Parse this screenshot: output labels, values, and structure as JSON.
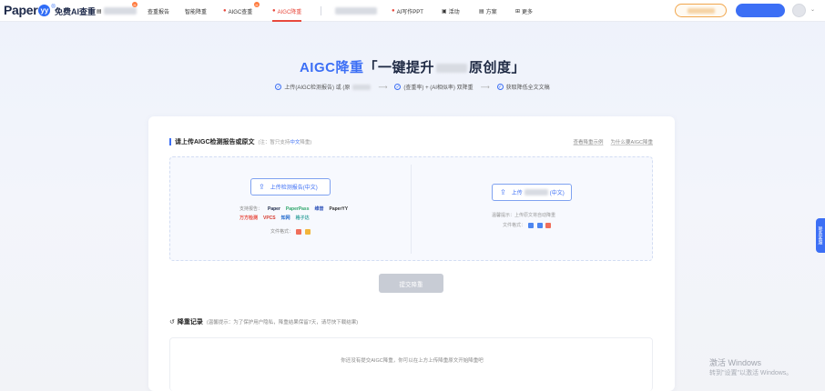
{
  "brand": {
    "logo_text": "Paper",
    "logo_badge": "yy",
    "sub_title": "免费AI查重"
  },
  "nav": {
    "items": [
      {
        "label": "查重报告",
        "icon": "report-icon"
      },
      {
        "label": "智能降重",
        "icon": ""
      },
      {
        "label": "AIGC查重",
        "icon": ""
      },
      {
        "label": "AIGC降重",
        "icon": "flame-icon",
        "active": true
      },
      {
        "label": "AI写作PPT",
        "icon": "flame-icon"
      },
      {
        "label": "活动",
        "icon": "gift-icon"
      },
      {
        "label": "方案",
        "icon": "plan-icon"
      },
      {
        "label": "更多",
        "icon": "grid-icon"
      }
    ],
    "hot_badge": "hot",
    "coin_label": "",
    "colors": {
      "active": "#e8493d",
      "accent": "#3c6ff5"
    }
  },
  "hero": {
    "title_blue": "AIGC降重",
    "title_rest_1": "「一键提升",
    "title_rest_2": "原创度」",
    "steps": [
      "上传(AIGC检测报告) 或 (原",
      "(查重率) + (AI相似率) 双降重",
      "获取降低全文文稿"
    ]
  },
  "upload": {
    "section_title": "请上传AIGC检测报告或原文",
    "section_note_pre": "(注：暂只支持",
    "section_note_hl": "中文",
    "section_note_post": "降重)",
    "link_sample": "查看降重示例",
    "link_why": "为什么要AIGC降重",
    "left_button": "上传检测报告(中文)",
    "left_support_label": "支持报告：",
    "left_format_label": "文件格式：",
    "partner_logos": [
      "Paper",
      "PaperPass",
      "维普",
      "PaperYY",
      "万方检测",
      "VPCS",
      "知网",
      "格子达"
    ],
    "right_button_pre": "上传",
    "right_button_post": "(中文)",
    "right_tip": "温馨提示：上传原文将自动降重",
    "right_format_label": "文件格式：",
    "submit": "提交降重"
  },
  "records": {
    "title": "降重记录",
    "note": "(温馨提示：为了保护用户隐私，降重结果保留7天，请尽快下载结果)",
    "empty_text": "你还没有提交AIGC降重，你可以在上方上传降重原文开始降重吧"
  },
  "side_tab": "联系客服",
  "watermark": {
    "line1": "激活 Windows",
    "line2": "转到\"设置\"以激活 Windows。"
  }
}
